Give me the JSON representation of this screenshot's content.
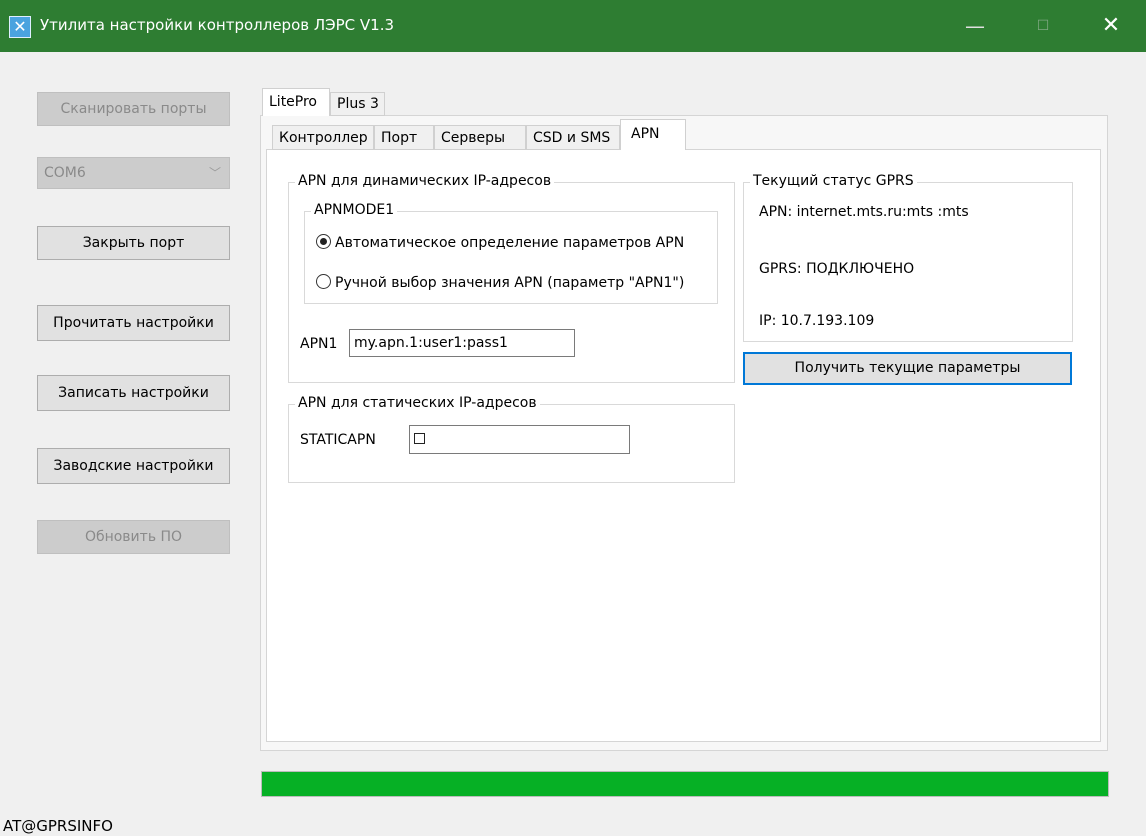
{
  "window": {
    "title": "Утилита настройки контроллеров ЛЭРС V1.3",
    "app_icon": "app-icon",
    "minimize_glyph": "—",
    "maximize_glyph": "☐",
    "close_glyph": "✕"
  },
  "sidebar": {
    "scan_ports": "Сканировать порты",
    "port_select_value": "COM6",
    "close_port": "Закрыть порт",
    "read_settings": "Прочитать настройки",
    "write_settings": "Записать настройки",
    "factory_settings": "Заводские настройки",
    "update_firmware": "Обновить ПО"
  },
  "device_tabs": [
    "LitePro",
    "Plus 3"
  ],
  "settings_tabs": [
    "Контроллер",
    "Порт",
    "Серверы",
    "CSD и SMS",
    "APN"
  ],
  "apn_dynamic": {
    "title": "APN для динамических IP-адресов",
    "mode_group_title": "APNMODE1",
    "option_auto": "Автоматическое определение параметров APN",
    "option_manual": "Ручной выбор значения APN (параметр \"APN1\")",
    "apn1_label": "APN1",
    "apn1_value": "my.apn.1:user1:pass1"
  },
  "apn_static": {
    "title": "APN для статических IP-адресов",
    "staticapn_label": "STATICAPN"
  },
  "gprs_status": {
    "title": "Текущий статус GPRS",
    "apn_line": "APN:  internet.mts.ru:mts :mts",
    "gprs_line": "GPRS:  ПОДКЛЮЧЕНО",
    "ip_line": "IP:  10.7.193.109",
    "get_params_button": "Получить текущие параметры"
  },
  "progress": {
    "fraction": 1.0,
    "color": "#06b025"
  },
  "status_bar": {
    "text": "AT@GPRSINFO"
  },
  "colors": {
    "titlebar": "#2e7d32",
    "accent_border": "#0078d7"
  }
}
